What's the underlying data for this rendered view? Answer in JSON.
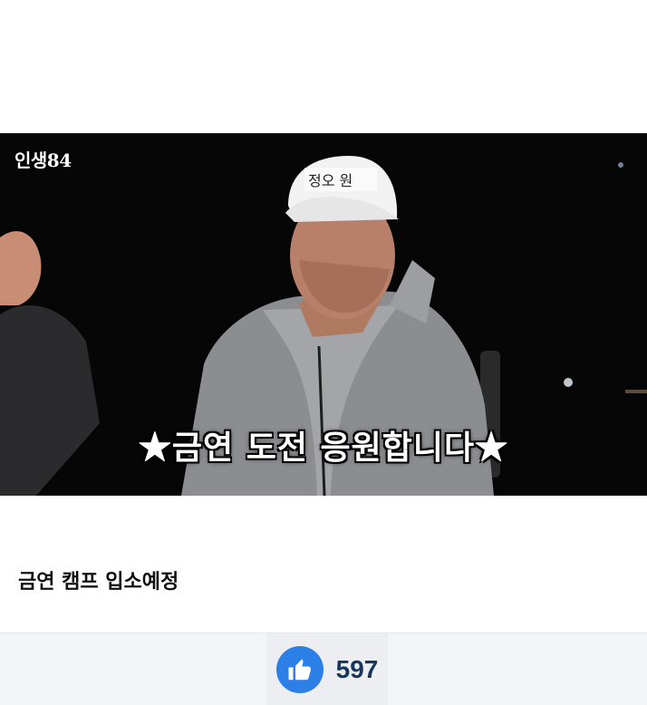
{
  "video": {
    "channel_logo": "인생84",
    "subtitle": "★금연 도전 응원합니다★",
    "cap_text": "정오 원"
  },
  "post": {
    "title": "금연 캠프 입소예정"
  },
  "reactions": {
    "like_icon": "thumbs-up-icon",
    "like_count": "597",
    "like_color": "#2d7fe8"
  }
}
